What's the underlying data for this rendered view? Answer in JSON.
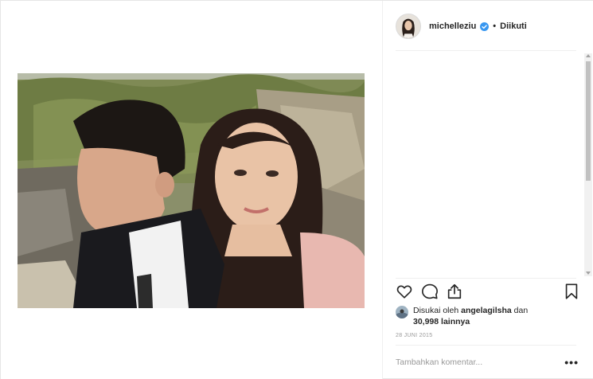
{
  "post": {
    "author": {
      "username": "michelleziu",
      "verified": true,
      "separator": "•",
      "follow_status": "Diikuti"
    },
    "media": {
      "kind": "photo"
    },
    "actions": {
      "like_icon": "heart-icon",
      "comment_icon": "comment-icon",
      "share_icon": "share-icon",
      "save_icon": "bookmark-icon"
    },
    "likes": {
      "prefix": "Disukai oleh",
      "user": "angelagilsha",
      "conjunction": "dan",
      "count": "30,998",
      "suffix": "lainnya"
    },
    "date": "28 JUNI 2015",
    "comment_box": {
      "placeholder": "Tambahkan komentar...",
      "value": "",
      "more_label": "•••"
    }
  },
  "colors": {
    "text": "#262626",
    "muted": "#999999",
    "border": "#efefef",
    "verified_blue": "#3897f0"
  }
}
